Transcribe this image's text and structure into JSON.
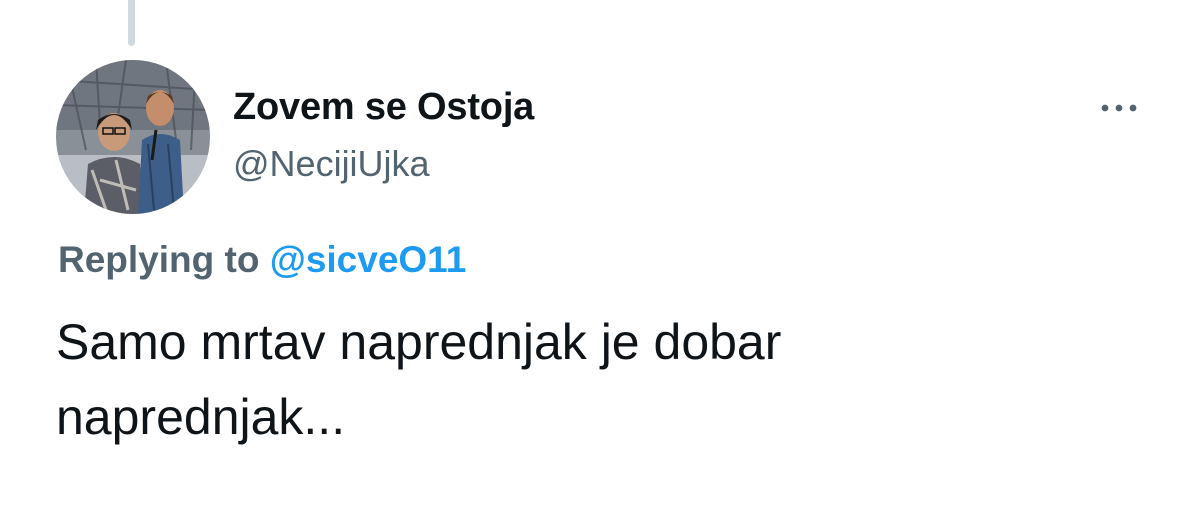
{
  "tweet": {
    "author": {
      "display_name": "Zovem se Ostoja",
      "handle": "@NecijiUjka",
      "avatar_icon": "profile-photo"
    },
    "more_icon": "more-horizontal-icon",
    "reply": {
      "prefix": "Replying to",
      "mention": "@sicveO11"
    },
    "text_lines": [
      "Samo mrtav naprednjak je dobar",
      "naprednjak..."
    ]
  },
  "colors": {
    "primary_text": "#0f1419",
    "secondary_text": "#536471",
    "link": "#1d9bf0",
    "thread_line": "#cfd9de",
    "background": "#ffffff"
  }
}
